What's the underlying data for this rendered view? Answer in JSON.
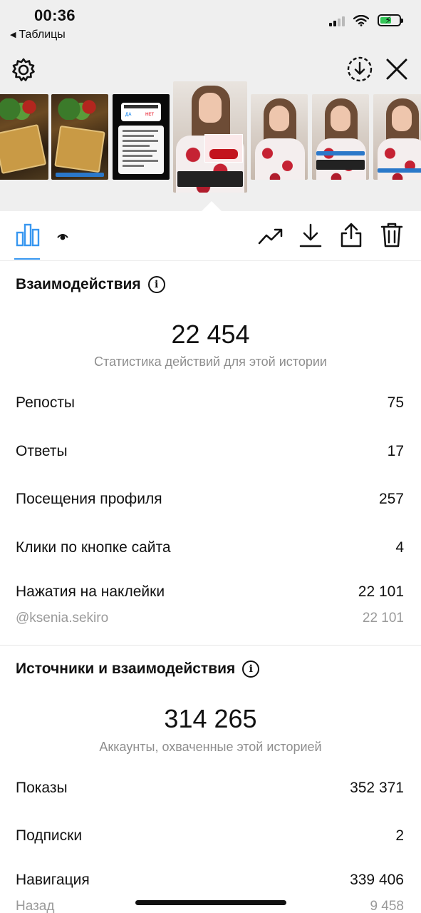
{
  "status_bar": {
    "time": "00:36",
    "back_label": "Таблицы",
    "battery_color": "#34c759"
  },
  "header": {
    "settings_icon": "gear-icon",
    "download_circle_icon": "download-circle-icon",
    "close_icon": "close-icon"
  },
  "thumbnails": {
    "poll_yes": "ДА",
    "poll_no": "НЕТ"
  },
  "toolbar": {
    "tabs": [
      "bar-chart-icon",
      "eye-icon"
    ],
    "actions": [
      "trending-up-icon",
      "download-icon",
      "share-icon",
      "trash-icon"
    ],
    "active_color": "#3897f0"
  },
  "interactions": {
    "title": "Взаимодействия",
    "total": "22 454",
    "subtitle": "Статистика действий для этой истории",
    "rows": [
      {
        "label": "Репосты",
        "value": "75"
      },
      {
        "label": "Ответы",
        "value": "17"
      },
      {
        "label": "Посещения профиля",
        "value": "257"
      },
      {
        "label": "Клики по кнопке сайта",
        "value": "4"
      },
      {
        "label": "Нажатия на наклейки",
        "value": "22 101"
      }
    ],
    "sticker_detail": {
      "label": "@ksenia.sekiro",
      "value": "22 101"
    }
  },
  "discovery": {
    "title": "Источники и взаимодействия",
    "total": "314 265",
    "subtitle": "Аккаунты, охваченные этой историей",
    "rows": [
      {
        "label": "Показы",
        "value": "352 371"
      },
      {
        "label": "Подписки",
        "value": "2"
      },
      {
        "label": "Навигация",
        "value": "339 406"
      }
    ],
    "nav_detail": {
      "label": "Назад",
      "value": "9 458"
    }
  }
}
